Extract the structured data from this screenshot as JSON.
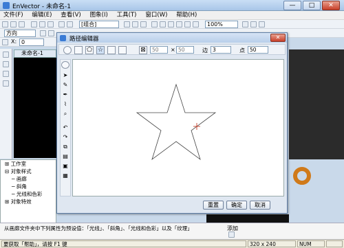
{
  "app": {
    "title": "EnVector - 未命名-1",
    "min": "—",
    "max": "□",
    "close": "✕"
  },
  "menu": [
    "文件(F)",
    "编辑(E)",
    "查看(V)",
    "图象(I)",
    "工具(T)",
    "窗口(W)",
    "帮助(H)"
  ],
  "toolbar": {
    "group_combo": "[组合]",
    "zoom": "100%",
    "direction": "方向",
    "x_label": "X:",
    "x_value": "0"
  },
  "document": {
    "tab_label": "未命名-1"
  },
  "dialog": {
    "title": "路径编辑器",
    "width_value": "50",
    "height_value": "50",
    "times_sign": "×",
    "edge_label": "边",
    "edge_value": "3",
    "point_label": "点",
    "point_value": "50",
    "buttons": {
      "reset": "重置",
      "ok": "确定",
      "cancel": "取消"
    }
  },
  "tree": {
    "items": [
      {
        "label": "工作室",
        "level": 0,
        "prefix": "⊞"
      },
      {
        "label": "对象样式",
        "level": 0,
        "prefix": "⊟"
      },
      {
        "label": "画廊",
        "level": 1,
        "prefix": "─"
      },
      {
        "label": "斜角",
        "level": 1,
        "prefix": "─"
      },
      {
        "label": "光线和色彩",
        "level": 1,
        "prefix": "─"
      },
      {
        "label": "对象特效",
        "level": 0,
        "prefix": "⊞"
      }
    ]
  },
  "info": {
    "text1": "从画廊文件夹中下列属性为预设值：「光线」、「斜角」、「光线和色彩」以及「纹理」",
    "add_label": "添加",
    "size": "320 x 240",
    "num": "NUM"
  },
  "status": {
    "help": "要获取「帮助」，请按 F1 键"
  },
  "colors": {
    "accent": "#c8402a",
    "selection": "#3a7bd5"
  }
}
